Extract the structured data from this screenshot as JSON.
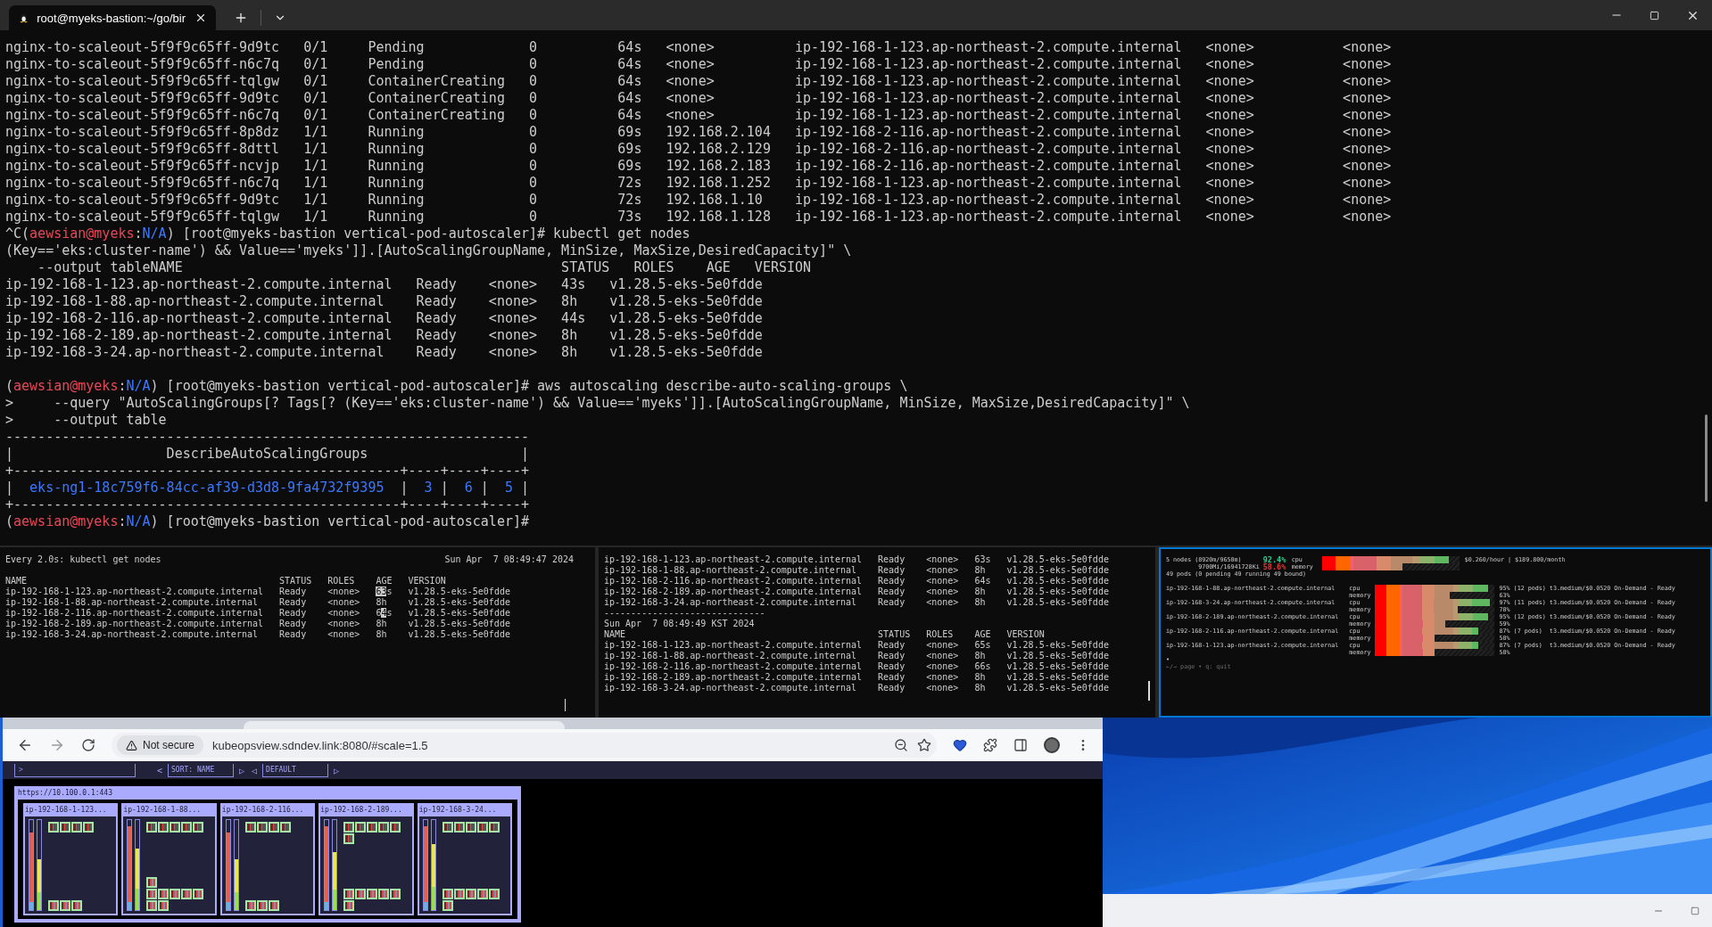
{
  "window": {
    "tab_title": "root@myeks-bastion:~/go/bir"
  },
  "terminal": {
    "lines": [
      {
        "kind": "text",
        "text": "nginx-to-scaleout-5f9f9c65ff-9d9tc   0/1     Pending             0          64s   <none>          ip-192-168-1-123.ap-northeast-2.compute.internal   <none>           <none>"
      },
      {
        "kind": "text",
        "text": "nginx-to-scaleout-5f9f9c65ff-n6c7q   0/1     Pending             0          64s   <none>          ip-192-168-1-123.ap-northeast-2.compute.internal   <none>           <none>"
      },
      {
        "kind": "text",
        "text": "nginx-to-scaleout-5f9f9c65ff-tqlgw   0/1     ContainerCreating   0          64s   <none>          ip-192-168-1-123.ap-northeast-2.compute.internal   <none>           <none>"
      },
      {
        "kind": "text",
        "text": "nginx-to-scaleout-5f9f9c65ff-9d9tc   0/1     ContainerCreating   0          64s   <none>          ip-192-168-1-123.ap-northeast-2.compute.internal   <none>           <none>"
      },
      {
        "kind": "text",
        "text": "nginx-to-scaleout-5f9f9c65ff-n6c7q   0/1     ContainerCreating   0          64s   <none>          ip-192-168-1-123.ap-northeast-2.compute.internal   <none>           <none>"
      },
      {
        "kind": "text",
        "text": "nginx-to-scaleout-5f9f9c65ff-8p8dz   1/1     Running             0          69s   192.168.2.104   ip-192-168-2-116.ap-northeast-2.compute.internal   <none>           <none>"
      },
      {
        "kind": "text",
        "text": "nginx-to-scaleout-5f9f9c65ff-8dttl   1/1     Running             0          69s   192.168.2.129   ip-192-168-2-116.ap-northeast-2.compute.internal   <none>           <none>"
      },
      {
        "kind": "text",
        "text": "nginx-to-scaleout-5f9f9c65ff-ncvjp   1/1     Running             0          69s   192.168.2.183   ip-192-168-2-116.ap-northeast-2.compute.internal   <none>           <none>"
      },
      {
        "kind": "text",
        "text": "nginx-to-scaleout-5f9f9c65ff-n6c7q   1/1     Running             0          72s   192.168.1.252   ip-192-168-1-123.ap-northeast-2.compute.internal   <none>           <none>"
      },
      {
        "kind": "text",
        "text": "nginx-to-scaleout-5f9f9c65ff-9d9tc   1/1     Running             0          72s   192.168.1.10    ip-192-168-1-123.ap-northeast-2.compute.internal   <none>           <none>"
      },
      {
        "kind": "text",
        "text": "nginx-to-scaleout-5f9f9c65ff-tqlgw   1/1     Running             0          73s   192.168.1.128   ip-192-168-1-123.ap-northeast-2.compute.internal   <none>           <none>"
      },
      {
        "kind": "rich",
        "segments": [
          {
            "text": "^C("
          },
          {
            "text": "aewsian@myeks",
            "color": "#e74856"
          },
          {
            "text": ":"
          },
          {
            "text": "N/A",
            "color": "#3b78ff"
          },
          {
            "text": ") [root@myeks-bastion vertical-pod-autoscaler]# kubectl get nodes"
          }
        ]
      },
      {
        "kind": "text",
        "text": "(Key=='eks:cluster-name') && Value=='myeks']].[AutoScalingGroupName, MinSize, MaxSize,DesiredCapacity]\" \\"
      },
      {
        "kind": "text",
        "text": "    --output tableNAME                                               STATUS   ROLES    AGE   VERSION"
      },
      {
        "kind": "text",
        "text": "ip-192-168-1-123.ap-northeast-2.compute.internal   Ready    <none>   43s   v1.28.5-eks-5e0fdde"
      },
      {
        "kind": "text",
        "text": "ip-192-168-1-88.ap-northeast-2.compute.internal    Ready    <none>   8h    v1.28.5-eks-5e0fdde"
      },
      {
        "kind": "text",
        "text": "ip-192-168-2-116.ap-northeast-2.compute.internal   Ready    <none>   44s   v1.28.5-eks-5e0fdde"
      },
      {
        "kind": "text",
        "text": "ip-192-168-2-189.ap-northeast-2.compute.internal   Ready    <none>   8h    v1.28.5-eks-5e0fdde"
      },
      {
        "kind": "text",
        "text": "ip-192-168-3-24.ap-northeast-2.compute.internal    Ready    <none>   8h    v1.28.5-eks-5e0fdde"
      },
      {
        "kind": "blank"
      },
      {
        "kind": "rich",
        "segments": [
          {
            "text": "("
          },
          {
            "text": "aewsian@myeks",
            "color": "#e74856"
          },
          {
            "text": ":"
          },
          {
            "text": "N/A",
            "color": "#3b78ff"
          },
          {
            "text": ") [root@myeks-bastion vertical-pod-autoscaler]# aws autoscaling describe-auto-scaling-groups \\"
          }
        ]
      },
      {
        "kind": "text",
        "text": ">     --query \"AutoScalingGroups[? Tags[? (Key=='eks:cluster-name') && Value=='myeks']].[AutoScalingGroupName, MinSize, MaxSize,DesiredCapacity]\" \\"
      },
      {
        "kind": "text",
        "text": ">     --output table"
      },
      {
        "kind": "text",
        "text": "-----------------------------------------------------------------"
      },
      {
        "kind": "text",
        "text": "|                   DescribeAutoScalingGroups                   |"
      },
      {
        "kind": "text",
        "text": "+------------------------------------------------+----+----+----+"
      },
      {
        "kind": "rich",
        "segments": [
          {
            "text": "|  "
          },
          {
            "text": "eks-ng1-18c759f6-84cc-af39-d3d8-9fa4732f9395",
            "color": "#3b78ff"
          },
          {
            "text": "  |  "
          },
          {
            "text": "3",
            "color": "#3b78ff"
          },
          {
            "text": " |  "
          },
          {
            "text": "6",
            "color": "#3b78ff"
          },
          {
            "text": " |  "
          },
          {
            "text": "5",
            "color": "#3b78ff"
          },
          {
            "text": " |"
          }
        ]
      },
      {
        "kind": "text",
        "text": "+------------------------------------------------+----+----+----+"
      },
      {
        "kind": "rich",
        "segments": [
          {
            "text": "("
          },
          {
            "text": "aewsian@myeks",
            "color": "#e74856"
          },
          {
            "text": ":"
          },
          {
            "text": "N/A",
            "color": "#3b78ff"
          },
          {
            "text": ") [root@myeks-bastion vertical-pod-autoscaler]#"
          }
        ]
      }
    ]
  },
  "watch_pane": {
    "title": "Every 2.0s: kubectl get nodes",
    "time": "Sun Apr  7 08:49:47 2024",
    "lines": [
      {
        "kind": "blank"
      },
      {
        "kind": "text",
        "text": "NAME                                               STATUS   ROLES    AGE   VERSION"
      },
      {
        "kind": "rich",
        "segments": [
          {
            "text": "ip-192-168-1-123.ap-northeast-2.compute.internal   Ready    <none>   "
          },
          {
            "text": "63",
            "highlighted": true
          },
          {
            "text": "s   v1.28.5-eks-5e0fdde"
          }
        ]
      },
      {
        "kind": "text",
        "text": "ip-192-168-1-88.ap-northeast-2.compute.internal    Ready    <none>   8h    v1.28.5-eks-5e0fdde"
      },
      {
        "kind": "rich",
        "segments": [
          {
            "text": "ip-192-168-2-116.ap-northeast-2.compute.internal   Ready    <none>   6"
          },
          {
            "text": "4",
            "highlighted": true
          },
          {
            "text": "s   v1.28.5-eks-5e0fdde"
          }
        ]
      },
      {
        "kind": "text",
        "text": "ip-192-168-2-189.ap-northeast-2.compute.internal   Ready    <none>   8h    v1.28.5-eks-5e0fdde"
      },
      {
        "kind": "text",
        "text": "ip-192-168-3-24.ap-northeast-2.compute.internal    Ready    <none>   8h    v1.28.5-eks-5e0fdde"
      }
    ]
  },
  "log_pane": {
    "lines": [
      {
        "kind": "text",
        "text": "ip-192-168-1-123.ap-northeast-2.compute.internal   Ready    <none>   63s   v1.28.5-eks-5e0fdde"
      },
      {
        "kind": "text",
        "text": "ip-192-168-1-88.ap-northeast-2.compute.internal    Ready    <none>   8h    v1.28.5-eks-5e0fdde"
      },
      {
        "kind": "text",
        "text": "ip-192-168-2-116.ap-northeast-2.compute.internal   Ready    <none>   64s   v1.28.5-eks-5e0fdde"
      },
      {
        "kind": "text",
        "text": "ip-192-168-2-189.ap-northeast-2.compute.internal   Ready    <none>   8h    v1.28.5-eks-5e0fdde"
      },
      {
        "kind": "text",
        "text": "ip-192-168-3-24.ap-northeast-2.compute.internal    Ready    <none>   8h    v1.28.5-eks-5e0fdde"
      },
      {
        "kind": "text",
        "text": "------------------------------"
      },
      {
        "kind": "text",
        "text": "Sun Apr  7 08:49:49 KST 2024"
      },
      {
        "kind": "text",
        "text": "NAME                                               STATUS   ROLES    AGE   VERSION"
      },
      {
        "kind": "text",
        "text": "ip-192-168-1-123.ap-northeast-2.compute.internal   Ready    <none>   65s   v1.28.5-eks-5e0fdde"
      },
      {
        "kind": "text",
        "text": "ip-192-168-1-88.ap-northeast-2.compute.internal    Ready    <none>   8h    v1.28.5-eks-5e0fdde"
      },
      {
        "kind": "text",
        "text": "ip-192-168-2-116.ap-northeast-2.compute.internal   Ready    <none>   66s   v1.28.5-eks-5e0fdde"
      },
      {
        "kind": "text",
        "text": "ip-192-168-2-189.ap-northeast-2.compute.internal   Ready    <none>   8h    v1.28.5-eks-5e0fdde"
      },
      {
        "kind": "text",
        "text": "ip-192-168-3-24.ap-northeast-2.compute.internal    Ready    <none>   8h    v1.28.5-eks-5e0fdde"
      }
    ]
  },
  "node_viewer": {
    "summary": [
      {
        "label": "5 nodes (8920m/9650m)",
        "percent": "92.4%",
        "color": "#2ecc8f",
        "resource": "cpu",
        "level": 0.924,
        "cost": "$0.260/hour | $189.800/month"
      },
      {
        "label": "9700Mi/16941728Ki",
        "percent": "58.6%",
        "color": "#e03b3b",
        "resource": "memory",
        "level": 0.586
      }
    ],
    "pods_line": "49 pods (0 pending 49 running 49 bound)",
    "nodes": [
      {
        "name": "ip-192-168-1-88.ap-northeast-2.compute.internal",
        "rows": [
          {
            "resource": "cpu",
            "level": 0.95,
            "detail": "95% (12 pods) t3.medium/$0.0520 On-Demand - Ready"
          },
          {
            "resource": "memory",
            "level": 0.63,
            "detail": "63%"
          }
        ]
      },
      {
        "name": "ip-192-168-3-24.ap-northeast-2.compute.internal",
        "rows": [
          {
            "resource": "cpu",
            "level": 0.97,
            "detail": "97% (11 pods) t3.medium/$0.0520 On-Demand - Ready"
          },
          {
            "resource": "memory",
            "level": 0.7,
            "detail": "70%"
          }
        ]
      },
      {
        "name": "ip-192-168-2-189.ap-northeast-2.compute.internal",
        "rows": [
          {
            "resource": "cpu",
            "level": 0.95,
            "detail": "95% (12 pods) t3.medium/$0.0520 On-Demand - Ready"
          },
          {
            "resource": "memory",
            "level": 0.59,
            "detail": "59%"
          }
        ]
      },
      {
        "name": "ip-192-168-2-116.ap-northeast-2.compute.internal",
        "rows": [
          {
            "resource": "cpu",
            "level": 0.87,
            "detail": "87% (7 pods)  t3.medium/$0.0520 On-Demand - Ready"
          },
          {
            "resource": "memory",
            "level": 0.5,
            "detail": "50%"
          }
        ]
      },
      {
        "name": "ip-192-168-1-123.ap-northeast-2.compute.internal",
        "rows": [
          {
            "resource": "cpu",
            "level": 0.87,
            "detail": "87% (7 pods)  t3.medium/$0.0520 On-Demand - Ready"
          },
          {
            "resource": "memory",
            "level": 0.5,
            "detail": "50%"
          }
        ]
      }
    ],
    "bullet": "•",
    "help": "←/→ page • q: quit"
  },
  "browser": {
    "security": "Not secure",
    "url": "kubeopsview.sdndev.link:8080/#scale=1.5",
    "toolbar": {
      "filter_prompt": ">",
      "controls": [
        {
          "kind": "arrow",
          "text": "<"
        },
        {
          "kind": "select",
          "text": "SORT: NAME"
        },
        {
          "kind": "arrow",
          "text": "▷"
        },
        {
          "kind": "arrow",
          "text": "◁"
        },
        {
          "kind": "select",
          "text": "DEFAULT"
        },
        {
          "kind": "arrow",
          "text": "▷"
        }
      ]
    },
    "cluster": {
      "title": "https://10.100.0.1:443",
      "nodes": [
        {
          "name": "ip-192-168-1-123...",
          "meters": [
            {
              "level": 0.86
            },
            {
              "level": 0.56
            }
          ],
          "pods": [
            {
              "kind": "app"
            },
            {
              "kind": "app"
            },
            {
              "kind": "app"
            },
            {
              "kind": "app"
            },
            {
              "kind": "system"
            },
            {
              "kind": "system"
            },
            {
              "kind": "system"
            }
          ]
        },
        {
          "name": "ip-192-168-1-88...",
          "meters": [
            {
              "level": 0.93
            },
            {
              "level": 0.68
            }
          ],
          "pods": [
            {
              "kind": "app"
            },
            {
              "kind": "app"
            },
            {
              "kind": "app"
            },
            {
              "kind": "app"
            },
            {
              "kind": "app"
            },
            {
              "kind": "extra"
            },
            {
              "kind": "system"
            },
            {
              "kind": "system"
            },
            {
              "kind": "system"
            },
            {
              "kind": "system"
            },
            {
              "kind": "system"
            },
            {
              "kind": "system"
            },
            {
              "kind": "system"
            }
          ]
        },
        {
          "name": "ip-192-168-2-116...",
          "meters": [
            {
              "level": 0.86
            },
            {
              "level": 0.56
            }
          ],
          "pods": [
            {
              "kind": "app"
            },
            {
              "kind": "app"
            },
            {
              "kind": "app"
            },
            {
              "kind": "app"
            },
            {
              "kind": "system"
            },
            {
              "kind": "system"
            },
            {
              "kind": "system"
            }
          ]
        },
        {
          "name": "ip-192-168-2-189...",
          "meters": [
            {
              "level": 0.93
            },
            {
              "level": 0.64
            }
          ],
          "pods": [
            {
              "kind": "app"
            },
            {
              "kind": "app"
            },
            {
              "kind": "app"
            },
            {
              "kind": "app"
            },
            {
              "kind": "app"
            },
            {
              "kind": "app"
            },
            {
              "kind": "system"
            },
            {
              "kind": "system"
            },
            {
              "kind": "system"
            },
            {
              "kind": "system"
            },
            {
              "kind": "system"
            },
            {
              "kind": "system"
            }
          ]
        },
        {
          "name": "ip-192-168-3-24...",
          "meters": [
            {
              "level": 0.93
            },
            {
              "level": 0.73
            }
          ],
          "pods": [
            {
              "kind": "app"
            },
            {
              "kind": "app"
            },
            {
              "kind": "app"
            },
            {
              "kind": "app"
            },
            {
              "kind": "app"
            },
            {
              "kind": "system"
            },
            {
              "kind": "system"
            },
            {
              "kind": "system"
            },
            {
              "kind": "system"
            },
            {
              "kind": "system"
            },
            {
              "kind": "system"
            }
          ]
        }
      ]
    }
  }
}
